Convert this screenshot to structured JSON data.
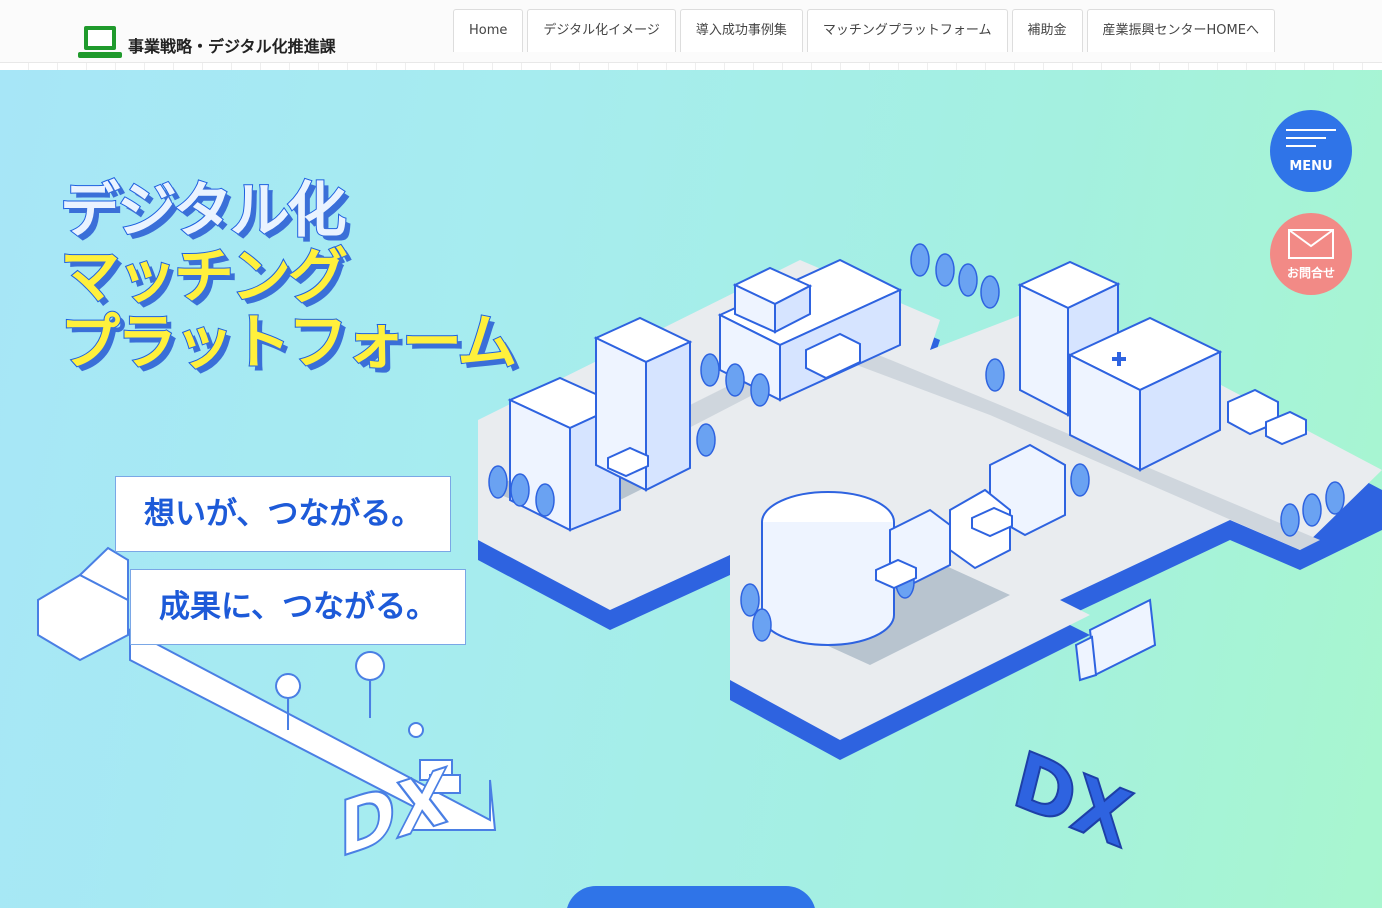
{
  "header": {
    "site_title": "事業戦略・デジタル化推進課",
    "nav": [
      {
        "label": "Home"
      },
      {
        "label": "デジタル化イメージ"
      },
      {
        "label": "導入成功事例集"
      },
      {
        "label": "マッチングプラットフォーム"
      },
      {
        "label": "補助金"
      },
      {
        "label": "産業振興センターHOMEへ"
      }
    ]
  },
  "hero": {
    "headline": [
      "デジタル化",
      "マッチング",
      "プラットフォーム"
    ],
    "taglines": [
      "想いが、つながる。",
      "成果に、つながる。"
    ],
    "dx_text": "DX"
  },
  "floating": {
    "menu_label": "MENU",
    "contact_label": "お問合せ"
  },
  "colors": {
    "accent_blue": "#2f74e8",
    "contact_pink": "#f28a86",
    "headline_yellow": "#fff03c",
    "brand_green": "#1f9a2c"
  }
}
